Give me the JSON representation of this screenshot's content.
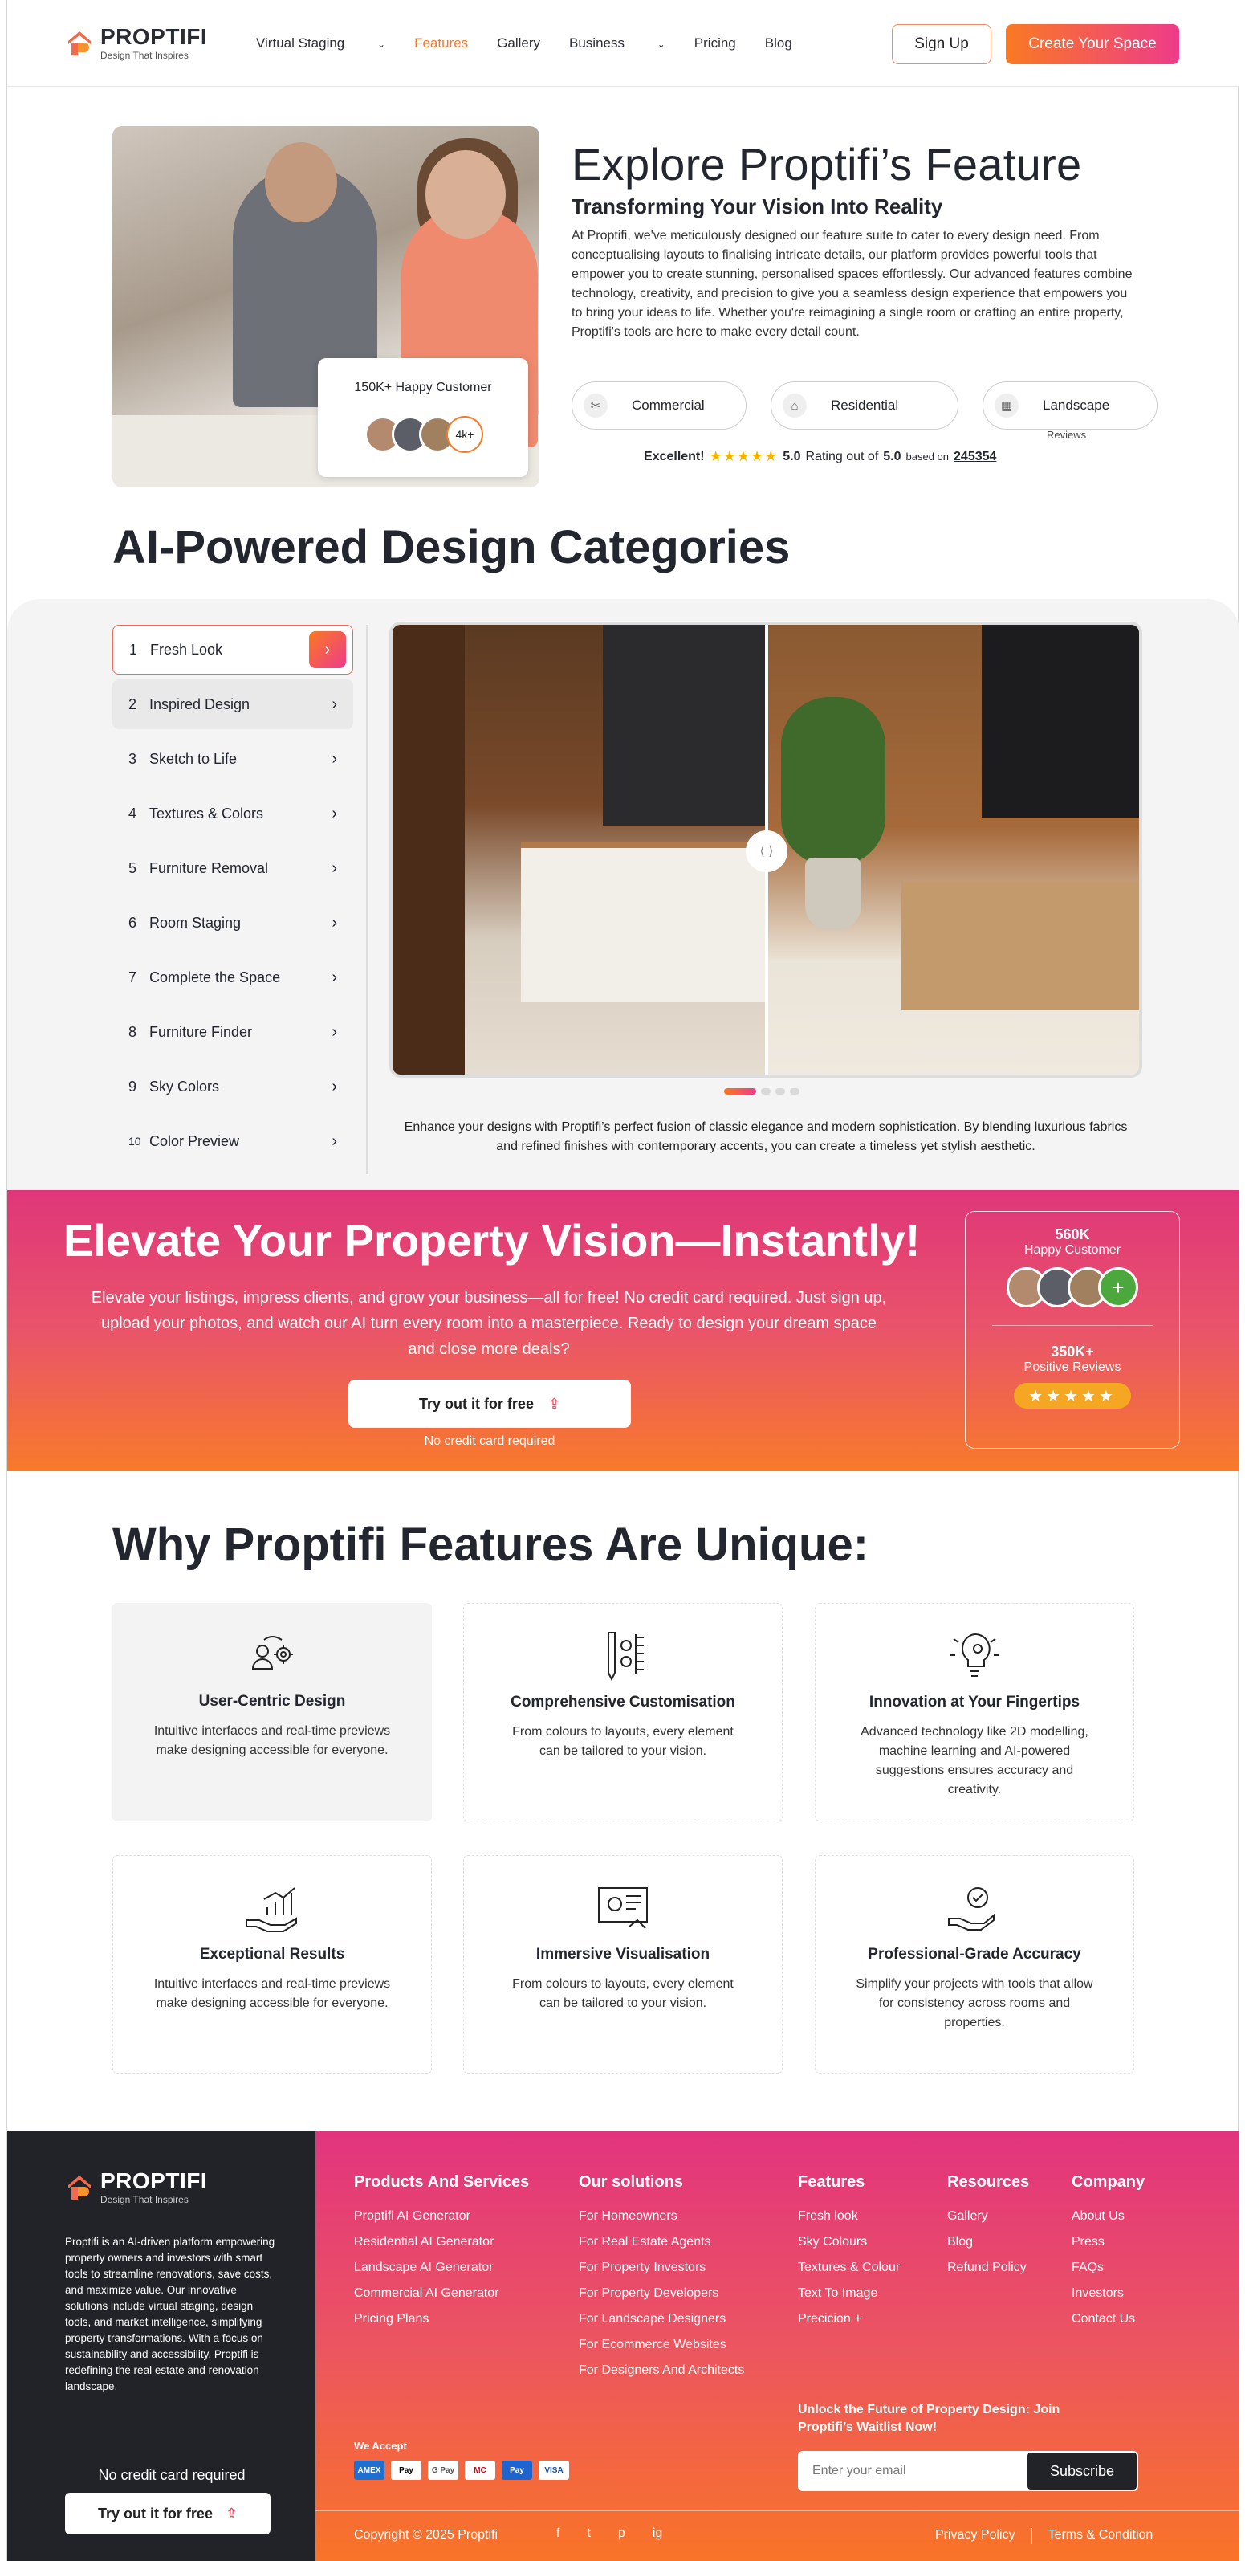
{
  "header": {
    "brand": "PROPTIFI",
    "tagline": "Design That Inspires",
    "nav": [
      "Virtual Staging",
      "Features",
      "Gallery",
      "Business",
      "Pricing",
      "Blog"
    ],
    "active_nav": "Features",
    "signup": "Sign Up",
    "create": "Create Your Space"
  },
  "hero": {
    "title": "Explore Proptifi’s Feature",
    "subtitle": "Transforming Your Vision Into Reality",
    "body": "At Proptifi, we've meticulously designed our feature suite to cater to every design need. From conceptualising layouts to finalising intricate details, our platform provides powerful tools that empower you to create stunning, personalised spaces effortlessly. Our advanced features combine technology, creativity, and precision to give you a seamless design experience that empowers you to bring your ideas to life. Whether you're reimagining a single room or crafting an entire property, Proptifi's tools are here to make every detail count.",
    "happy_customer": "150K+ Happy Customer",
    "avatar_more": "4k+",
    "pills": [
      "Commercial",
      "Residential",
      "Landscape"
    ],
    "reviews_label": "Reviews",
    "rating_word": "Excellent!",
    "rating_value": "5.0",
    "rating_text": "Rating out of",
    "rating_max": "5.0",
    "based_on": "based on",
    "review_count": "245354",
    "stars": "★★★★★"
  },
  "categories": {
    "title": "AI-Powered Design Categories",
    "items": [
      {
        "num": "1",
        "label": "Fresh Look"
      },
      {
        "num": "2",
        "label": "Inspired Design"
      },
      {
        "num": "3",
        "label": "Sketch to Life"
      },
      {
        "num": "4",
        "label": "Textures & Colors"
      },
      {
        "num": "5",
        "label": "Furniture Removal"
      },
      {
        "num": "6",
        "label": "Room Staging"
      },
      {
        "num": "7",
        "label": "Complete the Space"
      },
      {
        "num": "8",
        "label": "Furniture Finder"
      },
      {
        "num": "9",
        "label": "Sky Colors"
      },
      {
        "num": "10",
        "label": "Color Preview"
      }
    ],
    "description": "Enhance your designs with Proptifi’s perfect fusion of classic elegance and modern sophistication. By blending luxurious fabrics and refined finishes with contemporary accents, you can create a timeless yet stylish aesthetic."
  },
  "cta": {
    "title": "Elevate Your Property Vision—Instantly!",
    "body": "Elevate your listings, impress clients, and grow your business—all for free! No credit card required. Just sign up, upload your photos, and watch our AI turn every room into a masterpiece. Ready to design your dream space and close more deals?",
    "button": "Try out it for free",
    "note": "No credit card required",
    "stat1_value": "560K",
    "stat1_label": "Happy Customer",
    "stat2_value": "350K+",
    "stat2_label": "Positive Reviews",
    "plus": "+",
    "stars": "★★★★★"
  },
  "unique": {
    "title": "Why Proptifi Features Are Unique:",
    "cards": [
      {
        "icon": "user-gear-icon",
        "title": "User-Centric Design",
        "desc": "Intuitive interfaces and real-time previews make designing accessible for everyone."
      },
      {
        "icon": "pencil-gears-icon",
        "title": "Comprehensive Customisation",
        "desc": "From colours to layouts, every element can be tailored to your vision."
      },
      {
        "icon": "brain-bulb-icon",
        "title": "Innovation at Your Fingertips",
        "desc": "Advanced technology like 2D modelling, machine learning and AI-powered suggestions ensures accuracy and creativity."
      },
      {
        "icon": "hand-chart-icon",
        "title": "Exceptional Results",
        "desc": "Intuitive interfaces and real-time previews make designing accessible for everyone."
      },
      {
        "icon": "monitor-chart-icon",
        "title": "Immersive Visualisation",
        "desc": "From colours to layouts, every element can be tailored to your vision."
      },
      {
        "icon": "hand-check-badge-icon",
        "title": "Professional-Grade Accuracy",
        "desc": "Simplify your projects with tools that allow for consistency across rooms and properties."
      }
    ]
  },
  "footer": {
    "brand": "PROPTIFI",
    "tagline": "Design That Inspires",
    "about": "Proptifi is an AI-driven platform empowering property owners and investors with smart tools to streamline renovations, save costs, and maximize value. Our innovative solutions include virtual staging, design tools, and market intelligence, simplifying property transformations. With a focus on sustainability and accessibility, Proptifi is redefining the real estate and renovation landscape.",
    "no_cc": "No credit card required",
    "try": "Try out it for free",
    "columns": [
      {
        "title": "Products And Services",
        "links": [
          "Proptifi AI Generator",
          "Residential AI Generator",
          "Landscape AI Generator",
          "Commercial AI Generator",
          "Pricing Plans"
        ]
      },
      {
        "title": "Our solutions",
        "links": [
          "For Homeowners",
          "For Real Estate Agents",
          "For Property Investors",
          "For Property Developers",
          "For Landscape Designers",
          "For Ecommerce Websites",
          "For Designers And Architects"
        ]
      },
      {
        "title": "Features",
        "links": [
          "Fresh look",
          "Sky Colours",
          "Textures & Colour",
          "Text To Image",
          "Precicion +"
        ]
      },
      {
        "title": "Resources",
        "links": [
          "Gallery",
          "Blog",
          "Refund Policy"
        ]
      },
      {
        "title": "Company",
        "links": [
          "About Us",
          "Press",
          "FAQs",
          "Investors",
          "Contact Us"
        ]
      }
    ],
    "we_accept": "We Accept",
    "payments": [
      "AMEX",
      "Pay",
      "G Pay",
      "MC",
      "Pay",
      "VISA"
    ],
    "unlock": "Unlock the Future of Property Design: Join Proptifi’s Waitlist Now!",
    "email_placeholder": "Enter your email",
    "subscribe": "Subscribe",
    "copyright": "Copyright © 2025 Proptifi",
    "socials": [
      "f",
      "t",
      "p",
      "ig"
    ],
    "privacy": "Privacy Policy",
    "terms": "Terms & Condition"
  },
  "colors": {
    "accent_orange": "#f97a22",
    "accent_pink": "#ee3b8a",
    "dark": "#212328"
  }
}
